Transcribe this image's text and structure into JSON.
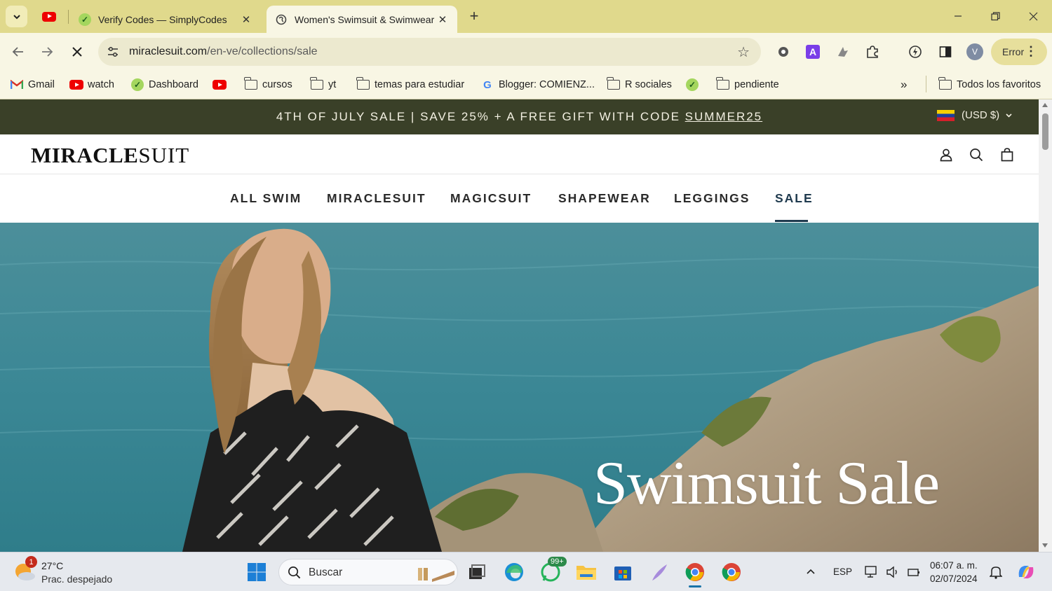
{
  "browser": {
    "tabs": [
      {
        "title": "Verify Codes — SimplyCodes",
        "active": false
      },
      {
        "title": "Women's Swimsuit & Swimwear",
        "active": true
      }
    ],
    "url_domain": "miraclesuit.com",
    "url_path": "/en-ve/collections/sale",
    "profile_initial": "V",
    "error_label": "Error",
    "bookmarks": [
      {
        "label": "Gmail",
        "icon": "gmail-icon"
      },
      {
        "label": "watch",
        "icon": "youtube-icon"
      },
      {
        "label": "Dashboard",
        "icon": "simplycodes-icon"
      },
      {
        "label": "",
        "icon": "youtube-icon"
      },
      {
        "label": "cursos",
        "icon": "folder-icon"
      },
      {
        "label": "yt",
        "icon": "folder-icon"
      },
      {
        "label": "temas para estudiar",
        "icon": "folder-icon"
      },
      {
        "label": "Blogger: COMIENZ...",
        "icon": "google-icon"
      },
      {
        "label": "R sociales",
        "icon": "folder-icon"
      },
      {
        "label": "",
        "icon": "simplycodes-icon"
      },
      {
        "label": "pendiente",
        "icon": "folder-icon"
      }
    ],
    "all_bookmarks": "Todos los favoritos"
  },
  "site": {
    "announcement_text": "4TH OF JULY SALE | SAVE 25% + A FREE GIFT WITH CODE ",
    "announcement_code": "SUMMER25",
    "currency": "(USD $)",
    "logo_bold": "MIRACLE",
    "logo_thin": "SUIT",
    "nav": [
      "ALL SWIM",
      "MIRACLESUIT",
      "MAGICSUIT",
      "SHAPEWEAR",
      "LEGGINGS",
      "SALE"
    ],
    "active_nav": "SALE",
    "hero_title": "Swimsuit Sale"
  },
  "taskbar": {
    "weather_temp": "27°C",
    "weather_cond": "Prac. despejado",
    "weather_badge": "1",
    "search_label": "Buscar",
    "whatsapp_badge": "99+",
    "language": "ESP",
    "time": "06:07 a. m.",
    "date": "02/07/2024"
  },
  "colors": {
    "tab_strip": "#e0d98c",
    "announcement_bg": "#3a4028",
    "nav_active": "#1f3a4e"
  }
}
